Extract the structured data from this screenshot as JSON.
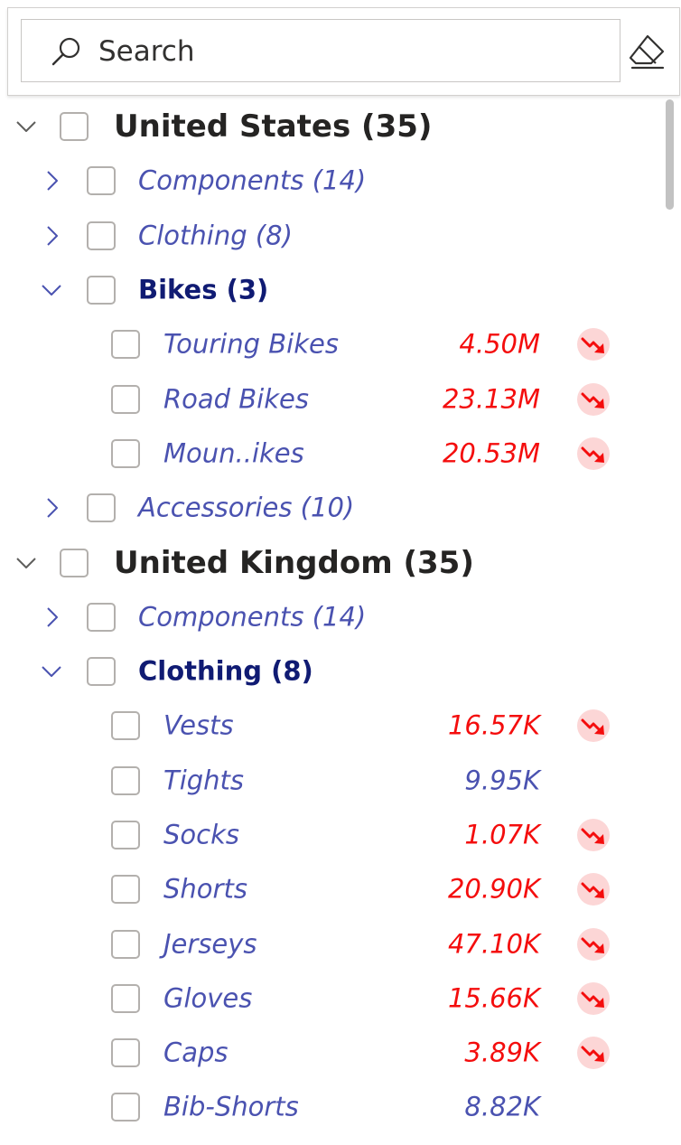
{
  "search": {
    "placeholder": "Search"
  },
  "colors": {
    "negative": "#f40d0d",
    "neutral": "#4a52b0",
    "expanded_category": "#101b73",
    "country": "#252423",
    "trend_badge_bg": "#fcd6d6"
  },
  "icons": {
    "search": "search-icon",
    "clear": "eraser-icon",
    "collapsed": "chevron-right-icon",
    "expanded": "chevron-down-icon",
    "trend": "trend-down-icon"
  },
  "tree": [
    {
      "level": 0,
      "expanded": true,
      "label": "United States (35)"
    },
    {
      "level": 1,
      "expanded": false,
      "label": "Components (14)"
    },
    {
      "level": 1,
      "expanded": false,
      "label": "Clothing (8)"
    },
    {
      "level": 1,
      "expanded": true,
      "label": "Bikes (3)"
    },
    {
      "level": 2,
      "label": "Touring Bikes",
      "value": "4.50M",
      "trend": "down"
    },
    {
      "level": 2,
      "label": "Road Bikes",
      "value": "23.13M",
      "trend": "down"
    },
    {
      "level": 2,
      "label": "Moun..ikes",
      "value": "20.53M",
      "trend": "down"
    },
    {
      "level": 1,
      "expanded": false,
      "label": "Accessories (10)"
    },
    {
      "level": 0,
      "expanded": true,
      "label": "United Kingdom (35)"
    },
    {
      "level": 1,
      "expanded": false,
      "label": "Components (14)"
    },
    {
      "level": 1,
      "expanded": true,
      "label": "Clothing (8)"
    },
    {
      "level": 2,
      "label": "Vests",
      "value": "16.57K",
      "trend": "down"
    },
    {
      "level": 2,
      "label": "Tights",
      "value": "9.95K",
      "trend": "none"
    },
    {
      "level": 2,
      "label": "Socks",
      "value": "1.07K",
      "trend": "down"
    },
    {
      "level": 2,
      "label": "Shorts",
      "value": "20.90K",
      "trend": "down"
    },
    {
      "level": 2,
      "label": "Jerseys",
      "value": "47.10K",
      "trend": "down"
    },
    {
      "level": 2,
      "label": "Gloves",
      "value": "15.66K",
      "trend": "down"
    },
    {
      "level": 2,
      "label": "Caps",
      "value": "3.89K",
      "trend": "down"
    },
    {
      "level": 2,
      "label": "Bib-Shorts",
      "value": "8.82K",
      "trend": "none"
    }
  ]
}
